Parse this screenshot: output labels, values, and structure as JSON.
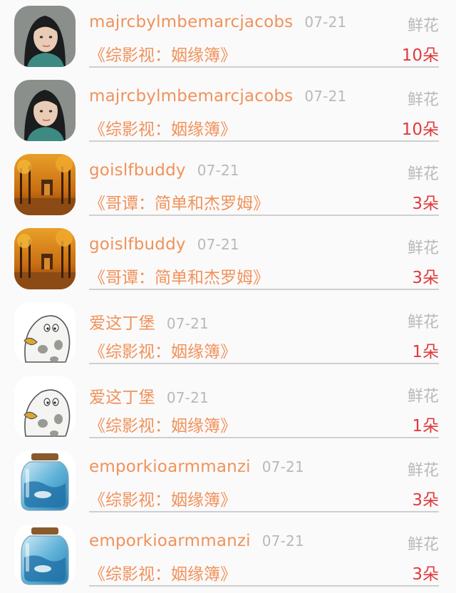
{
  "rows": [
    {
      "avatar": "woman-portrait",
      "name": "majrcbylmbemarcjacobs",
      "date": "07-21",
      "type": "鲜花",
      "book": "《综影视：姻缘簿》",
      "qty": "10朵"
    },
    {
      "avatar": "woman-portrait",
      "name": "majrcbylmbemarcjacobs",
      "date": "07-21",
      "type": "鲜花",
      "book": "《综影视：姻缘簿》",
      "qty": "10朵"
    },
    {
      "avatar": "autumn-forest",
      "name": "goislfbuddy",
      "date": "07-21",
      "type": "鲜花",
      "book": "《哥谭：简单和杰罗姆》",
      "qty": "3朵"
    },
    {
      "avatar": "autumn-forest",
      "name": "goislfbuddy",
      "date": "07-21",
      "type": "鲜花",
      "book": "《哥谭：简单和杰罗姆》",
      "qty": "3朵"
    },
    {
      "avatar": "cartoon-seal",
      "name": "爱这丁堡",
      "date": "07-21",
      "type": "鲜花",
      "book": "《综影视：姻缘簿》",
      "qty": "1朵"
    },
    {
      "avatar": "cartoon-seal",
      "name": "爱这丁堡",
      "date": "07-21",
      "type": "鲜花",
      "book": "《综影视：姻缘簿》",
      "qty": "1朵"
    },
    {
      "avatar": "glass-jar",
      "name": "emporkioarmmanzi",
      "date": "07-21",
      "type": "鲜花",
      "book": "《综影视：姻缘簿》",
      "qty": "3朵"
    },
    {
      "avatar": "glass-jar",
      "name": "emporkioarmmanzi",
      "date": "07-21",
      "type": "鲜花",
      "book": "《综影视：姻缘簿》",
      "qty": "3朵"
    }
  ]
}
